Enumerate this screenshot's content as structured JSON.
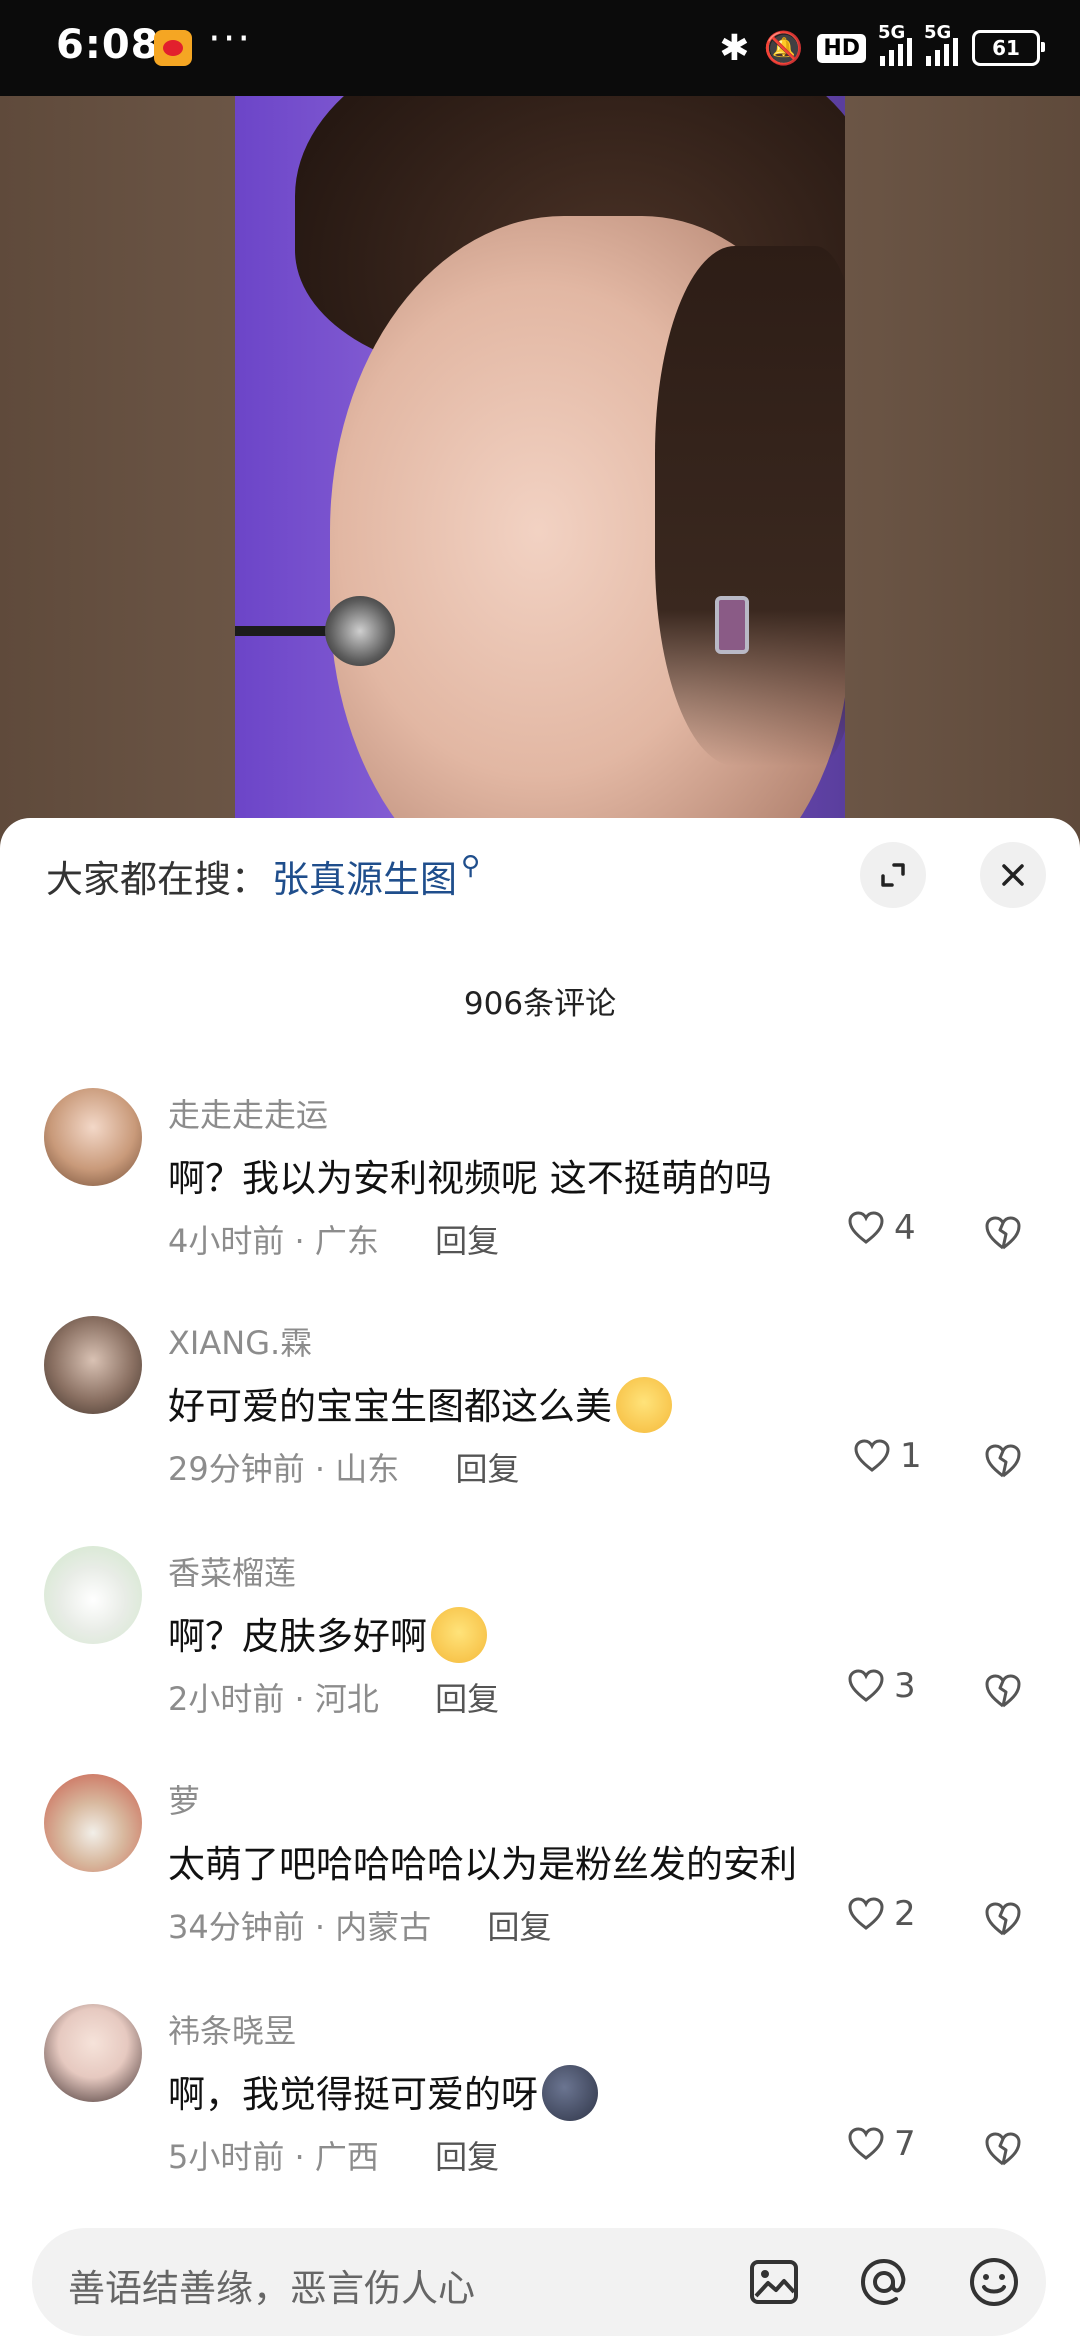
{
  "status_bar": {
    "time": "6:08",
    "more": "···",
    "bluetooth_icon": "bluetooth-icon",
    "mute_icon": "mute-bell-icon",
    "hd": "HD",
    "net1": "5G",
    "net2": "5G",
    "battery": "61"
  },
  "header": {
    "search_label": "大家都在搜：",
    "search_term": "张真源生图",
    "search_icon": "search-icon",
    "expand_icon": "expand-icon",
    "close_icon": "close-icon"
  },
  "comment_count": "906条评论",
  "comments": [
    {
      "user": "走走走走运",
      "text": "啊？我以为安利视频呢 这不挺萌的吗",
      "emoji": "",
      "time": "4小时前",
      "location": "广东",
      "reply": "回复",
      "likes": "4",
      "avatar_color": "#c99a7a"
    },
    {
      "user": "XIANG.霖",
      "text": "好可爱的宝宝生图都这么美",
      "emoji": "cry-emoji",
      "time": "29分钟前",
      "location": "山东",
      "reply": "回复",
      "likes": "1",
      "avatar_color": "#8a7062"
    },
    {
      "user": "香菜榴莲",
      "text": "啊？皮肤多好啊",
      "emoji": "dizzy-emoji",
      "time": "2小时前",
      "location": "河北",
      "reply": "回复",
      "likes": "3",
      "avatar_color": "#cfe8c9"
    },
    {
      "user": "萝",
      "text": "太萌了吧哈哈哈哈以为是粉丝发的安利",
      "emoji": "",
      "time": "34分钟前",
      "location": "内蒙古",
      "reply": "回复",
      "likes": "2",
      "avatar_color": "#c95a4a"
    },
    {
      "user": "祎条晓昱",
      "text": "啊，我觉得挺可爱的呀",
      "emoji": "moon-emoji",
      "time": "5小时前",
      "location": "广西",
      "reply": "回复",
      "likes": "7",
      "avatar_color": "#e6c9c0"
    }
  ],
  "input_bar": {
    "placeholder": "善语结善缘，恶言伤人心",
    "image_icon": "image-icon",
    "at_icon": "at-icon",
    "emoji_icon": "emoji-icon"
  }
}
